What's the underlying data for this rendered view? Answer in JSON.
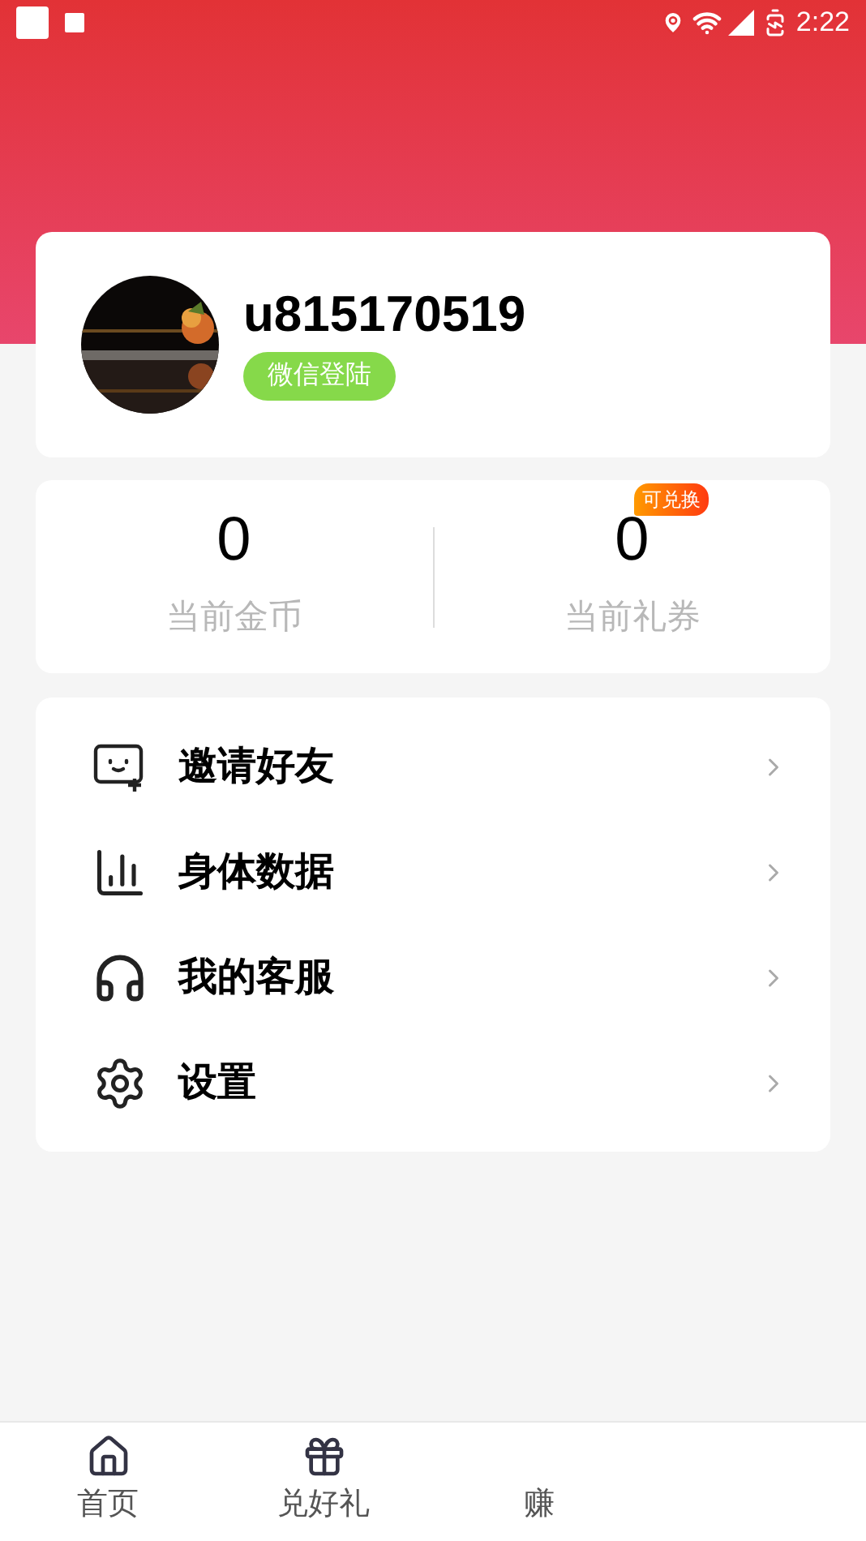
{
  "status_bar": {
    "time": "2:22"
  },
  "profile": {
    "username": "u815170519",
    "login_badge": "微信登陆"
  },
  "stats": [
    {
      "value": "0",
      "label": "当前金币"
    },
    {
      "value": "0",
      "label": "当前礼券",
      "badge": "可兑换"
    }
  ],
  "menu": [
    {
      "kind": "invite",
      "label": "邀请好友"
    },
    {
      "kind": "chart",
      "label": "身体数据"
    },
    {
      "kind": "service",
      "label": "我的客服"
    },
    {
      "kind": "settings",
      "label": "设置"
    }
  ],
  "bottom_nav": [
    {
      "kind": "home",
      "label": "首页"
    },
    {
      "kind": "gift",
      "label": "兑好礼"
    },
    {
      "kind": "none",
      "label": "赚"
    }
  ]
}
